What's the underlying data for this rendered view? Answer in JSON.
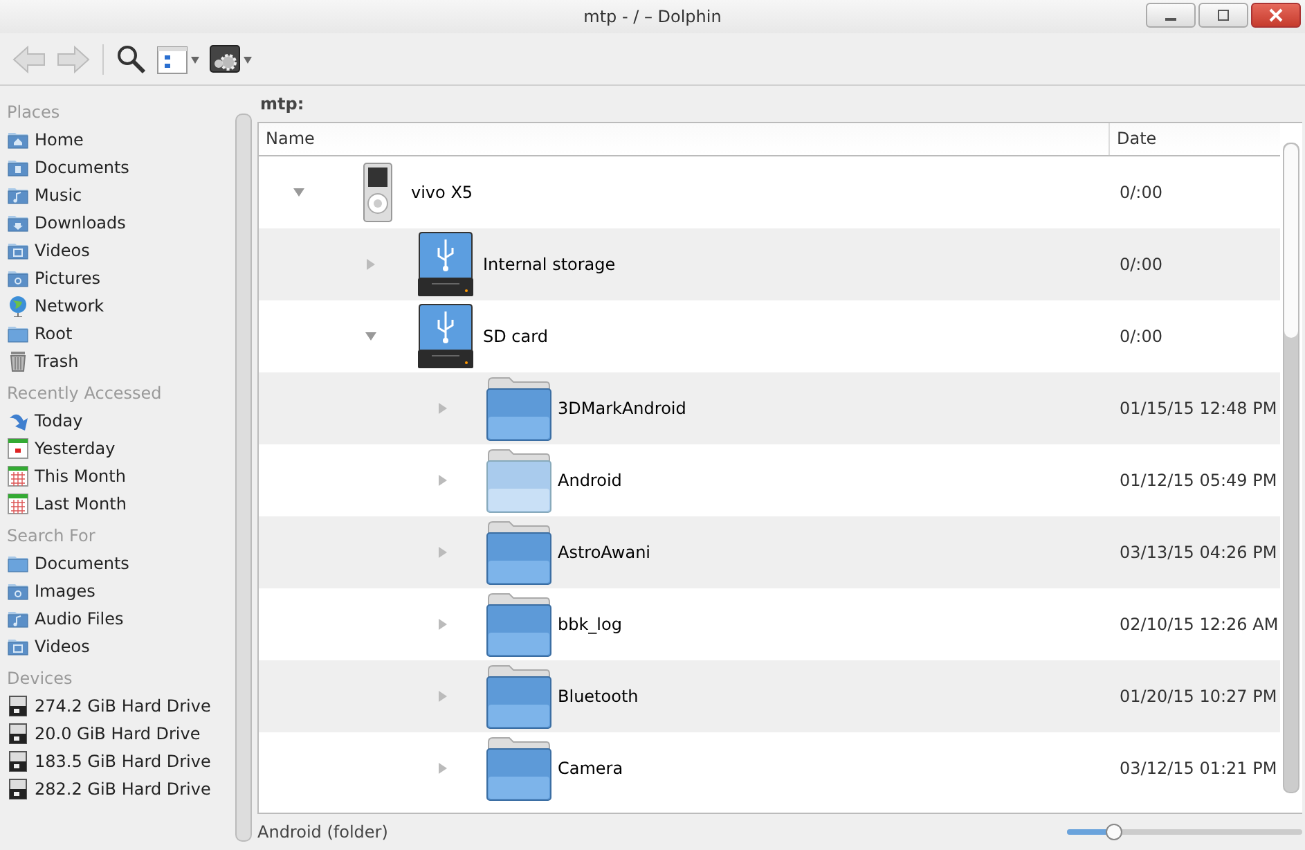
{
  "window": {
    "title": "mtp - / – Dolphin"
  },
  "toolbar": {
    "back_disabled": true,
    "forward_disabled": true
  },
  "sidebar": {
    "sections": [
      {
        "title": "Places",
        "items": [
          {
            "label": "Home",
            "kind": "home"
          },
          {
            "label": "Documents",
            "kind": "docs"
          },
          {
            "label": "Music",
            "kind": "music"
          },
          {
            "label": "Downloads",
            "kind": "download"
          },
          {
            "label": "Videos",
            "kind": "video"
          },
          {
            "label": "Pictures",
            "kind": "picture"
          },
          {
            "label": "Network",
            "kind": "network"
          },
          {
            "label": "Root",
            "kind": "folder"
          },
          {
            "label": "Trash",
            "kind": "trash"
          }
        ]
      },
      {
        "title": "Recently Accessed",
        "items": [
          {
            "label": "Today",
            "kind": "today"
          },
          {
            "label": "Yesterday",
            "kind": "day"
          },
          {
            "label": "This Month",
            "kind": "month"
          },
          {
            "label": "Last Month",
            "kind": "month"
          }
        ]
      },
      {
        "title": "Search For",
        "items": [
          {
            "label": "Documents",
            "kind": "folder"
          },
          {
            "label": "Images",
            "kind": "picture"
          },
          {
            "label": "Audio Files",
            "kind": "music"
          },
          {
            "label": "Videos",
            "kind": "video"
          }
        ]
      },
      {
        "title": "Devices",
        "items": [
          {
            "label": "274.2 GiB Hard Drive",
            "kind": "drive"
          },
          {
            "label": "20.0 GiB Hard Drive",
            "kind": "drive"
          },
          {
            "label": "183.5 GiB Hard Drive",
            "kind": "drive"
          },
          {
            "label": "282.2 GiB Hard Drive",
            "kind": "drive"
          }
        ]
      }
    ]
  },
  "location": "mtp:",
  "table": {
    "columns": [
      "Name",
      "Date"
    ],
    "rows": [
      {
        "name": "vivo X5",
        "date": "0/:00",
        "kind": "device",
        "expanded": true,
        "children": [
          {
            "name": "Internal storage",
            "date": "0/:00",
            "kind": "usb-drive",
            "expanded": false
          },
          {
            "name": "SD card",
            "date": "0/:00",
            "kind": "usb-drive",
            "expanded": true,
            "children": [
              {
                "name": "3DMarkAndroid",
                "date": "01/15/15 12:48 PM",
                "kind": "folder",
                "expanded": false,
                "hovered": false
              },
              {
                "name": "Android",
                "date": "01/12/15 05:49 PM",
                "kind": "folder",
                "expanded": false,
                "hovered": true
              },
              {
                "name": "AstroAwani",
                "date": "03/13/15 04:26 PM",
                "kind": "folder",
                "expanded": false,
                "hovered": false
              },
              {
                "name": "bbk_log",
                "date": "02/10/15 12:26 AM",
                "kind": "folder",
                "expanded": false,
                "hovered": false
              },
              {
                "name": "Bluetooth",
                "date": "01/20/15 10:27 PM",
                "kind": "folder",
                "expanded": false,
                "hovered": false
              },
              {
                "name": "Camera",
                "date": "03/12/15 01:21 PM",
                "kind": "folder",
                "expanded": false,
                "hovered": false
              }
            ]
          }
        ]
      }
    ]
  },
  "status_bar": {
    "text": "Android (folder)",
    "zoom": {
      "level": 0.2
    }
  }
}
